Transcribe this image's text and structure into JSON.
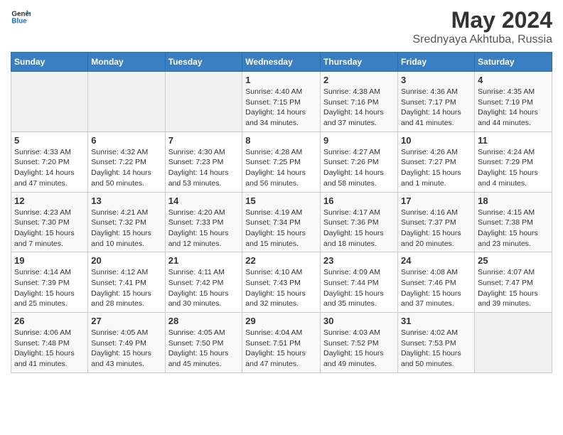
{
  "header": {
    "logo_general": "General",
    "logo_blue": "Blue",
    "title": "May 2024",
    "subtitle": "Srednyaya Akhtuba, Russia"
  },
  "weekdays": [
    "Sunday",
    "Monday",
    "Tuesday",
    "Wednesday",
    "Thursday",
    "Friday",
    "Saturday"
  ],
  "weeks": [
    [
      {
        "day": "",
        "empty": true
      },
      {
        "day": "",
        "empty": true
      },
      {
        "day": "",
        "empty": true
      },
      {
        "day": "1",
        "sunrise": "Sunrise: 4:40 AM",
        "sunset": "Sunset: 7:15 PM",
        "daylight": "Daylight: 14 hours and 34 minutes."
      },
      {
        "day": "2",
        "sunrise": "Sunrise: 4:38 AM",
        "sunset": "Sunset: 7:16 PM",
        "daylight": "Daylight: 14 hours and 37 minutes."
      },
      {
        "day": "3",
        "sunrise": "Sunrise: 4:36 AM",
        "sunset": "Sunset: 7:17 PM",
        "daylight": "Daylight: 14 hours and 41 minutes."
      },
      {
        "day": "4",
        "sunrise": "Sunrise: 4:35 AM",
        "sunset": "Sunset: 7:19 PM",
        "daylight": "Daylight: 14 hours and 44 minutes."
      }
    ],
    [
      {
        "day": "5",
        "sunrise": "Sunrise: 4:33 AM",
        "sunset": "Sunset: 7:20 PM",
        "daylight": "Daylight: 14 hours and 47 minutes."
      },
      {
        "day": "6",
        "sunrise": "Sunrise: 4:32 AM",
        "sunset": "Sunset: 7:22 PM",
        "daylight": "Daylight: 14 hours and 50 minutes."
      },
      {
        "day": "7",
        "sunrise": "Sunrise: 4:30 AM",
        "sunset": "Sunset: 7:23 PM",
        "daylight": "Daylight: 14 hours and 53 minutes."
      },
      {
        "day": "8",
        "sunrise": "Sunrise: 4:28 AM",
        "sunset": "Sunset: 7:25 PM",
        "daylight": "Daylight: 14 hours and 56 minutes."
      },
      {
        "day": "9",
        "sunrise": "Sunrise: 4:27 AM",
        "sunset": "Sunset: 7:26 PM",
        "daylight": "Daylight: 14 hours and 58 minutes."
      },
      {
        "day": "10",
        "sunrise": "Sunrise: 4:26 AM",
        "sunset": "Sunset: 7:27 PM",
        "daylight": "Daylight: 15 hours and 1 minute."
      },
      {
        "day": "11",
        "sunrise": "Sunrise: 4:24 AM",
        "sunset": "Sunset: 7:29 PM",
        "daylight": "Daylight: 15 hours and 4 minutes."
      }
    ],
    [
      {
        "day": "12",
        "sunrise": "Sunrise: 4:23 AM",
        "sunset": "Sunset: 7:30 PM",
        "daylight": "Daylight: 15 hours and 7 minutes."
      },
      {
        "day": "13",
        "sunrise": "Sunrise: 4:21 AM",
        "sunset": "Sunset: 7:32 PM",
        "daylight": "Daylight: 15 hours and 10 minutes."
      },
      {
        "day": "14",
        "sunrise": "Sunrise: 4:20 AM",
        "sunset": "Sunset: 7:33 PM",
        "daylight": "Daylight: 15 hours and 12 minutes."
      },
      {
        "day": "15",
        "sunrise": "Sunrise: 4:19 AM",
        "sunset": "Sunset: 7:34 PM",
        "daylight": "Daylight: 15 hours and 15 minutes."
      },
      {
        "day": "16",
        "sunrise": "Sunrise: 4:17 AM",
        "sunset": "Sunset: 7:36 PM",
        "daylight": "Daylight: 15 hours and 18 minutes."
      },
      {
        "day": "17",
        "sunrise": "Sunrise: 4:16 AM",
        "sunset": "Sunset: 7:37 PM",
        "daylight": "Daylight: 15 hours and 20 minutes."
      },
      {
        "day": "18",
        "sunrise": "Sunrise: 4:15 AM",
        "sunset": "Sunset: 7:38 PM",
        "daylight": "Daylight: 15 hours and 23 minutes."
      }
    ],
    [
      {
        "day": "19",
        "sunrise": "Sunrise: 4:14 AM",
        "sunset": "Sunset: 7:39 PM",
        "daylight": "Daylight: 15 hours and 25 minutes."
      },
      {
        "day": "20",
        "sunrise": "Sunrise: 4:12 AM",
        "sunset": "Sunset: 7:41 PM",
        "daylight": "Daylight: 15 hours and 28 minutes."
      },
      {
        "day": "21",
        "sunrise": "Sunrise: 4:11 AM",
        "sunset": "Sunset: 7:42 PM",
        "daylight": "Daylight: 15 hours and 30 minutes."
      },
      {
        "day": "22",
        "sunrise": "Sunrise: 4:10 AM",
        "sunset": "Sunset: 7:43 PM",
        "daylight": "Daylight: 15 hours and 32 minutes."
      },
      {
        "day": "23",
        "sunrise": "Sunrise: 4:09 AM",
        "sunset": "Sunset: 7:44 PM",
        "daylight": "Daylight: 15 hours and 35 minutes."
      },
      {
        "day": "24",
        "sunrise": "Sunrise: 4:08 AM",
        "sunset": "Sunset: 7:46 PM",
        "daylight": "Daylight: 15 hours and 37 minutes."
      },
      {
        "day": "25",
        "sunrise": "Sunrise: 4:07 AM",
        "sunset": "Sunset: 7:47 PM",
        "daylight": "Daylight: 15 hours and 39 minutes."
      }
    ],
    [
      {
        "day": "26",
        "sunrise": "Sunrise: 4:06 AM",
        "sunset": "Sunset: 7:48 PM",
        "daylight": "Daylight: 15 hours and 41 minutes."
      },
      {
        "day": "27",
        "sunrise": "Sunrise: 4:05 AM",
        "sunset": "Sunset: 7:49 PM",
        "daylight": "Daylight: 15 hours and 43 minutes."
      },
      {
        "day": "28",
        "sunrise": "Sunrise: 4:05 AM",
        "sunset": "Sunset: 7:50 PM",
        "daylight": "Daylight: 15 hours and 45 minutes."
      },
      {
        "day": "29",
        "sunrise": "Sunrise: 4:04 AM",
        "sunset": "Sunset: 7:51 PM",
        "daylight": "Daylight: 15 hours and 47 minutes."
      },
      {
        "day": "30",
        "sunrise": "Sunrise: 4:03 AM",
        "sunset": "Sunset: 7:52 PM",
        "daylight": "Daylight: 15 hours and 49 minutes."
      },
      {
        "day": "31",
        "sunrise": "Sunrise: 4:02 AM",
        "sunset": "Sunset: 7:53 PM",
        "daylight": "Daylight: 15 hours and 50 minutes."
      },
      {
        "day": "",
        "empty": true
      }
    ]
  ]
}
